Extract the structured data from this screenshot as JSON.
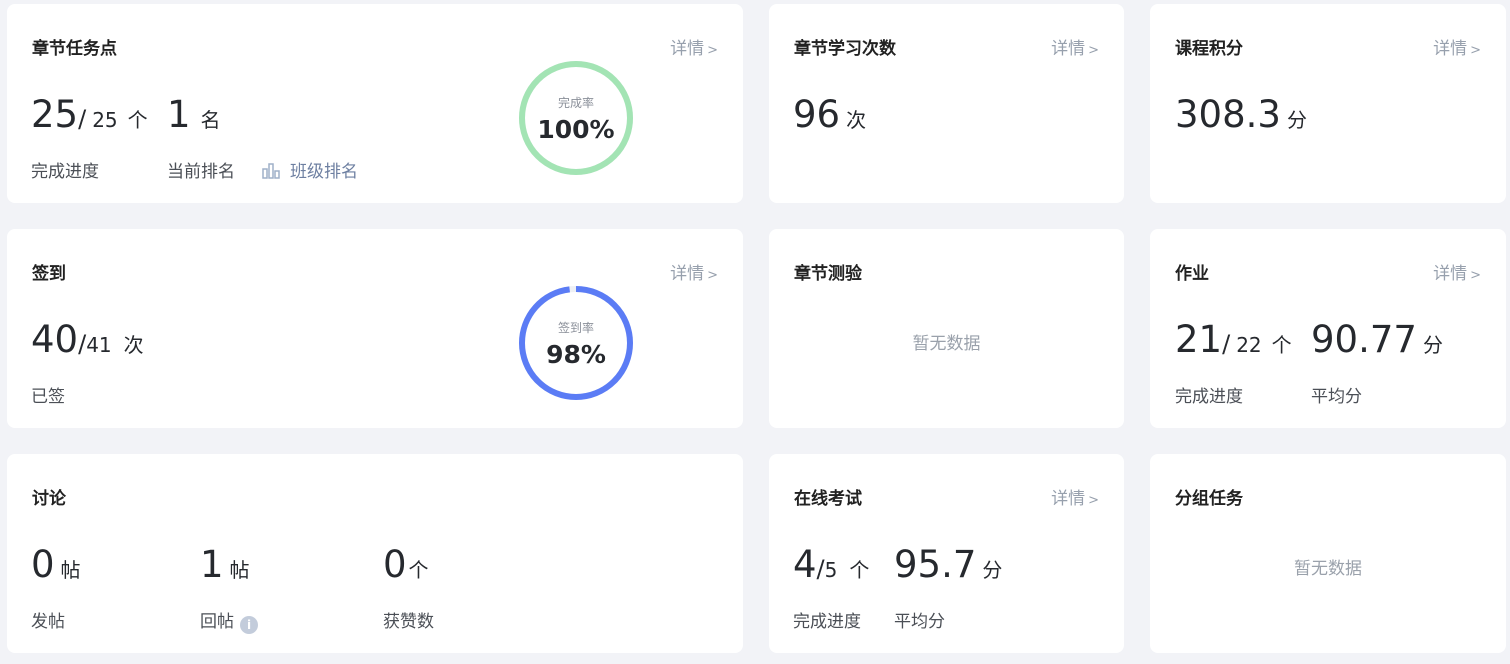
{
  "common": {
    "more": "详情"
  },
  "chapter_tasks": {
    "title": "章节任务点",
    "done": "25",
    "total": "25",
    "unit": "个",
    "progress_label": "完成进度",
    "rank": "1",
    "rank_unit": "名",
    "rank_label": "当前排名",
    "class_rank_link": "班级排名",
    "ring_label": "完成率",
    "ring_value": "100%",
    "ring_percent": 100,
    "ring_color": "#a3e4b4"
  },
  "chapter_study": {
    "title": "章节学习次数",
    "value": "96",
    "unit": "次"
  },
  "course_points": {
    "title": "课程积分",
    "value": "308.3",
    "unit": "分"
  },
  "checkin": {
    "title": "签到",
    "done": "40",
    "total": "41",
    "unit": "次",
    "label": "已签",
    "ring_label": "签到率",
    "ring_value": "98%",
    "ring_percent": 98,
    "ring_color": "#5b7cf5"
  },
  "chapter_quiz": {
    "title": "章节测验",
    "empty": "暂无数据"
  },
  "homework": {
    "title": "作业",
    "done": "21",
    "total": "22",
    "unit": "个",
    "progress_label": "完成进度",
    "avg": "90.77",
    "avg_unit": "分",
    "avg_label": "平均分"
  },
  "discussion": {
    "title": "讨论",
    "posts": "0",
    "posts_unit": "帖",
    "posts_label": "发帖",
    "replies": "1",
    "replies_unit": "帖",
    "replies_label": "回帖",
    "likes": "0",
    "likes_unit": "个",
    "likes_label": "获赞数"
  },
  "online_exam": {
    "title": "在线考试",
    "done": "4",
    "total": "5",
    "unit": "个",
    "progress_label": "完成进度",
    "avg": "95.7",
    "avg_unit": "分",
    "avg_label": "平均分"
  },
  "group_tasks": {
    "title": "分组任务",
    "empty": "暂无数据"
  },
  "icons": {
    "chevron": "chevron-right-icon",
    "bar_chart": "bar-chart-icon",
    "info": "info-icon"
  }
}
